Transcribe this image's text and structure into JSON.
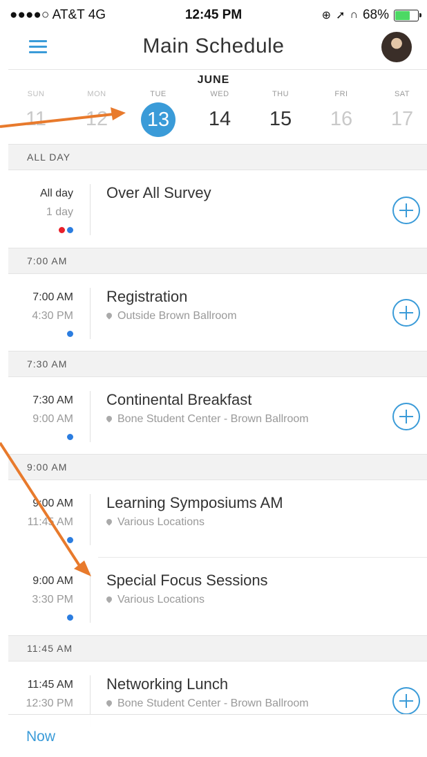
{
  "status_bar": {
    "carrier": "●●●●○ AT&T  4G",
    "time": "12:45 PM",
    "battery": "68%",
    "icons": [
      "orientation-lock-icon",
      "location-arrow-icon",
      "headphones-icon",
      "battery-icon"
    ]
  },
  "header": {
    "title": "Main Schedule"
  },
  "calendar": {
    "month": "JUNE",
    "days": [
      {
        "name": "SUN",
        "num": "11"
      },
      {
        "name": "MON",
        "num": "12"
      },
      {
        "name": "TUE",
        "num": "13"
      },
      {
        "name": "WED",
        "num": "14"
      },
      {
        "name": "THU",
        "num": "15"
      },
      {
        "name": "FRI",
        "num": "16"
      },
      {
        "name": "SAT",
        "num": "17"
      }
    ],
    "selected": "13"
  },
  "sections": [
    {
      "label": "ALL DAY"
    },
    {
      "label": "7:00 AM"
    },
    {
      "label": "7:30 AM"
    },
    {
      "label": "9:00 AM"
    },
    {
      "label": "11:45 AM"
    }
  ],
  "events": [
    {
      "start": "All day",
      "end": "1 day",
      "title": "Over All Survey",
      "location": "",
      "dots": [
        "#e8202a",
        "#2b7de0"
      ]
    },
    {
      "start": "7:00 AM",
      "end": "4:30 PM",
      "title": "Registration",
      "location": "Outside Brown Ballroom",
      "dots": [
        "#2b7de0"
      ]
    },
    {
      "start": "7:30 AM",
      "end": "9:00 AM",
      "title": "Continental Breakfast",
      "location": "Bone Student Center - Brown Ballroom",
      "dots": [
        "#2b7de0"
      ]
    },
    {
      "start": "9:00 AM",
      "end": "11:45 AM",
      "title": "Learning Symposiums AM",
      "location": "Various Locations",
      "dots": [
        "#2b7de0"
      ]
    },
    {
      "start": "9:00 AM",
      "end": "3:30 PM",
      "title": "Special Focus Sessions",
      "location": "Various Locations",
      "dots": [
        "#2b7de0"
      ]
    },
    {
      "start": "11:45 AM",
      "end": "12:30 PM",
      "title": "Networking Lunch",
      "location": "Bone Student Center - Brown Ballroom",
      "dots": [
        "#2b7de0"
      ]
    }
  ],
  "footer": {
    "now_label": "Now"
  },
  "colors": {
    "accent": "#3a9bd8",
    "arrow": "#e87a2c"
  }
}
